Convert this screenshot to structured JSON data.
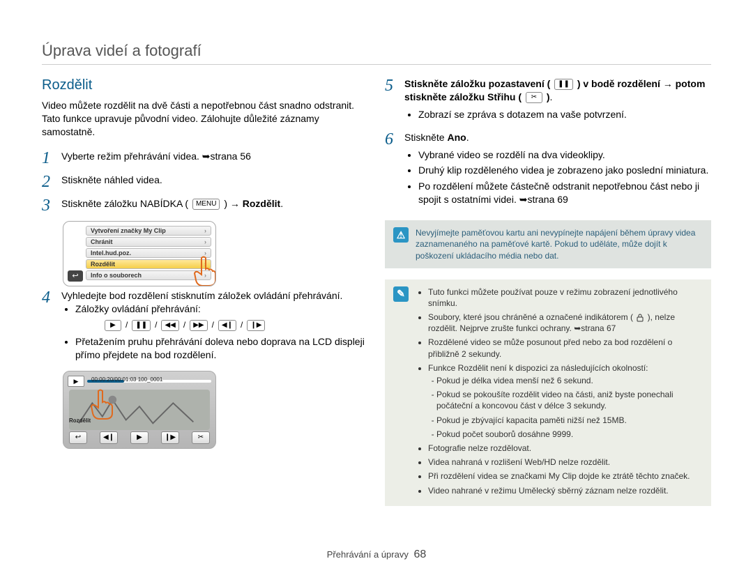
{
  "header": {
    "title": "Úprava videí a fotografí"
  },
  "section": {
    "title": "Rozdělit",
    "intro": "Video můžete rozdělit na dvě části a nepotřebnou část snadno odstranit. Tato funkce upravuje původní video. Zálohujte důležité záznamy samostatně."
  },
  "steps": [
    {
      "num": "1",
      "text": "Vyberte režim přehrávání videa. ➥strana 56"
    },
    {
      "num": "2",
      "text": "Stiskněte náhled videa."
    },
    {
      "num": "3",
      "text_a": "Stiskněte záložku NABÍDKA (",
      "text_b": "Rozdělit"
    },
    {
      "num": "4",
      "text": "Vyhledejte bod rozdělení stisknutím záložek ovládání přehrávání.",
      "sub1": "Záložky ovládání přehrávání:",
      "sub2": "Přetažením pruhu přehrávání doleva nebo doprava na LCD displeji přímo přejdete na bod rozdělení."
    },
    {
      "num": "5",
      "line1_a": "Stiskněte záložku pozastavení ( ",
      "line1_b": " ) v bodě rozdělení ",
      "line2_a": "→ potom stiskněte záložku Střihu ( ",
      "sub1": "Zobrazí se zpráva s dotazem na vaše potvrzení."
    },
    {
      "num": "6",
      "text_a": "Stiskněte ",
      "text_b": "Ano",
      "sub1": "Vybrané video se rozdělí na dva videoklipy.",
      "sub2": "Druhý klip rozděleného videa je zobrazeno jako poslední miniatura.",
      "sub3": "Po rozdělení můžete částečně odstranit nepotřebnou část nebo ji spojit s ostatními videi. ➥strana 69"
    }
  ],
  "menu": {
    "items": [
      "Vytvoření značky My Clip",
      "Chránit",
      "Intel.hud.poz.",
      "Rozdělit",
      "Info o souborech"
    ]
  },
  "split_ui": {
    "timecode": "00:00:20/00:01:03   100_0001",
    "label": "Rozdělit"
  },
  "icons": {
    "menu": "MENU"
  },
  "warn_note": "Nevyjímejte paměťovou kartu ani nevypínejte napájení během úpravy videa zaznamenaného na paměťové kartě. Pokud to uděláte, může dojít k poškození ukládacího média nebo dat.",
  "info_note": {
    "0": "Tuto funkci můžete používat pouze v režimu zobrazení jednotlivého snímku.",
    "1a": "Soubory, které jsou chráněné a označené indikátorem (",
    "1b": "), nelze rozdělit. Nejprve zrušte funkci ochrany. ➥strana 67",
    "2": "Rozdělené video se může posunout před nebo za bod rozdělení o přibližně 2 sekundy.",
    "3": "Funkce Rozdělit není k dispozici za následujících okolností:",
    "3a": "Pokud je délka videa menší než 6 sekund.",
    "3b": "Pokud se pokoušíte rozdělit video na části, aniž byste ponechali počáteční a koncovou část v délce 3 sekundy.",
    "3c": "Pokud je zbývající kapacita paměti nižší než 15MB.",
    "3d": "Pokud počet souborů dosáhne 9999.",
    "4": "Fotografie nelze rozdělovat.",
    "5": "Videa nahraná v rozlišení Web/HD nelze rozdělit.",
    "6": "Při rozdělení videa se značkami My Clip dojde ke ztrátě těchto značek.",
    "7": "Video nahrané v režimu Umělecký sběrný záznam nelze rozdělit."
  },
  "footer": {
    "section": "Přehrávání a úpravy",
    "page": "68"
  }
}
